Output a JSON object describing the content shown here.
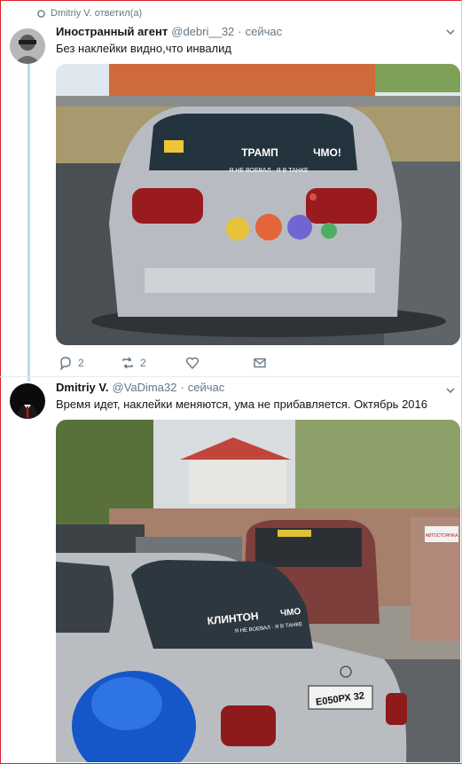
{
  "reply_context": {
    "text": "Dmitriy V. ответил(а)"
  },
  "tweets": [
    {
      "name": "Иностранный агент",
      "handle": "@debri__32",
      "separator": "·",
      "time": "сейчас",
      "text": "Без наклейки видно,что инвалид",
      "photo": {
        "sticker_line1": "ТРАМП",
        "sticker_line2": "ЧМО!",
        "sticker_small": "Я НЕ ВОЕВАЛ · Я В ТАНКЕ"
      },
      "actions": {
        "replies": "2",
        "retweets": "2"
      }
    },
    {
      "name": "Dmitriy V.",
      "handle": "@VaDima32",
      "separator": "·",
      "time": "сейчас",
      "text": "Время идет, наклейки меняются, ума не прибавляется. Октябрь 2016",
      "photo": {
        "sticker_line1": "КЛИНТОН",
        "sticker_line2": "ЧМО",
        "sticker_small": "Я НЕ ВОЕВАЛ · Я В ТАНКЕ",
        "plate": "Е050РХ 32",
        "wall_sign": "АВТОСТОЯНКА"
      }
    }
  ],
  "colors": {
    "thread_line": "#b8dbf2",
    "secondary": "#657786",
    "border": "#d9232d"
  }
}
